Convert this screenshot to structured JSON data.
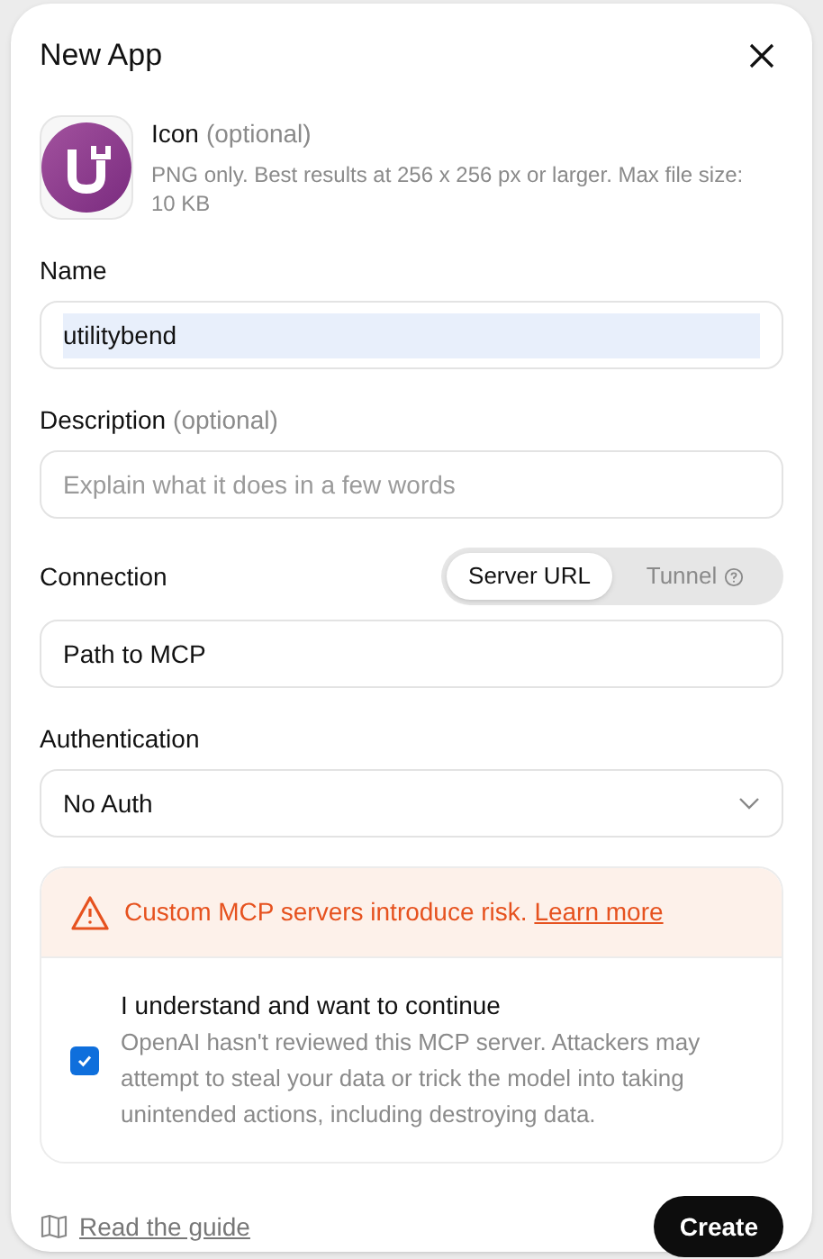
{
  "dialog": {
    "title": "New App"
  },
  "icon_field": {
    "label": "Icon",
    "optional": "(optional)",
    "hint": "PNG only. Best results at 256 x 256 px or larger. Max file size: 10 KB"
  },
  "name_field": {
    "label": "Name",
    "value": "utilitybend",
    "selected_text": true
  },
  "description_field": {
    "label": "Description",
    "optional": "(optional)",
    "placeholder": "Explain what it does in a few words"
  },
  "connection": {
    "label": "Connection",
    "options": [
      {
        "label": "Server URL",
        "selected": true,
        "help": false
      },
      {
        "label": "Tunnel",
        "selected": false,
        "help": true
      }
    ],
    "value": "Path to MCP"
  },
  "authentication": {
    "label": "Authentication",
    "value": "No Auth"
  },
  "warning": {
    "text": "Custom MCP servers introduce risk.",
    "link": "Learn more"
  },
  "consent": {
    "checked": true,
    "title": "I understand and want to continue",
    "body": "OpenAI hasn't reviewed this MCP server. Attackers may attempt to steal your data or trick the model into taking unintended actions, including destroying data."
  },
  "footer": {
    "guide_link": "Read the guide",
    "create_button": "Create"
  }
}
